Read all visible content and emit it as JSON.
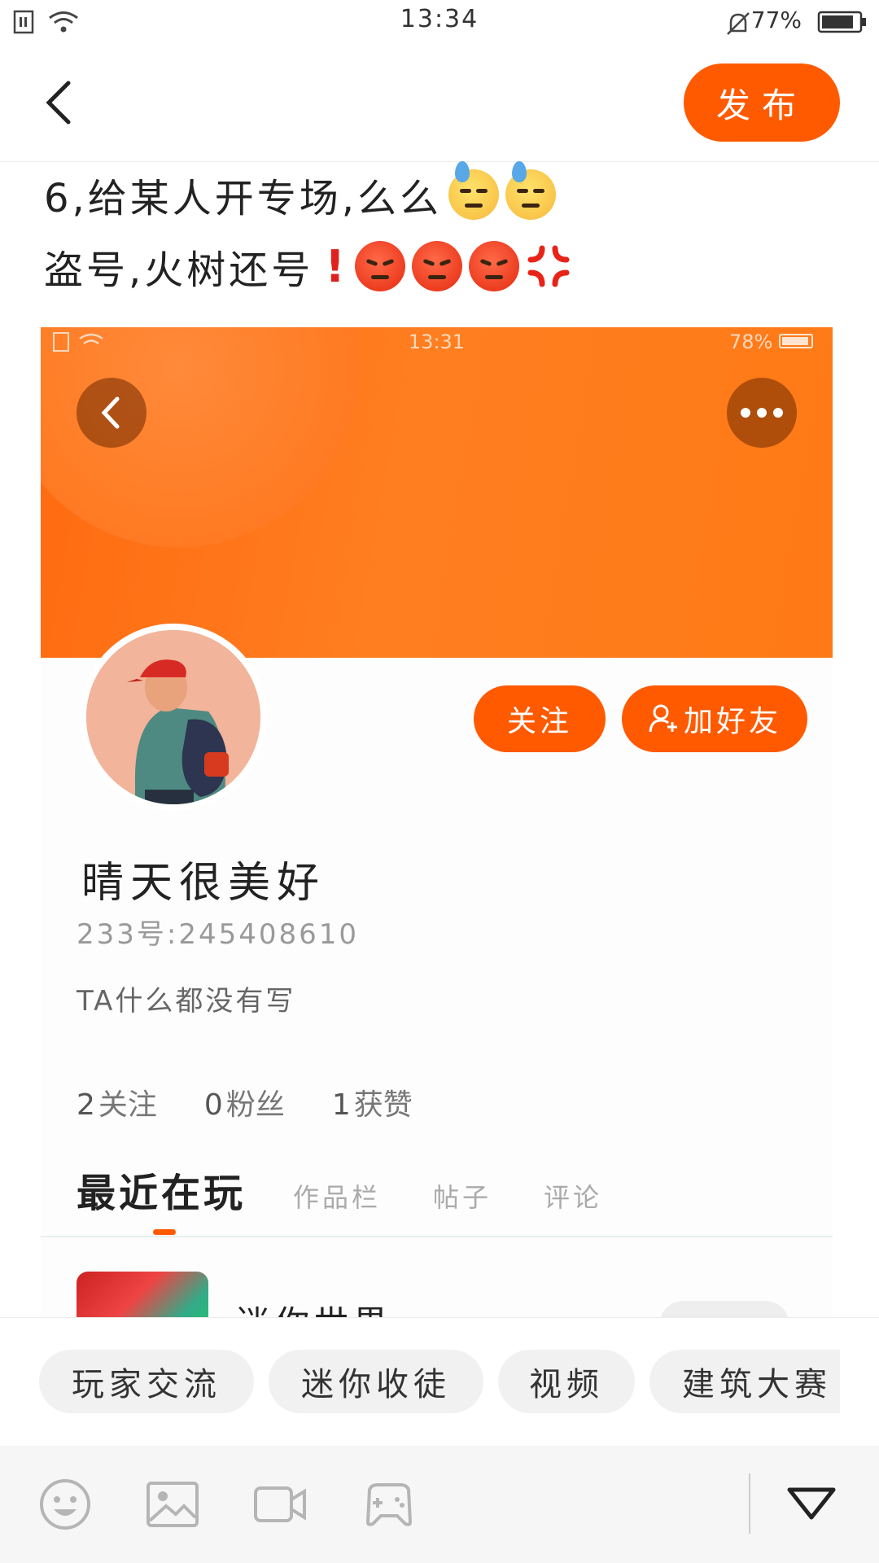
{
  "status_bar": {
    "time": "13:34",
    "battery": "77%"
  },
  "header": {
    "back_label": "",
    "publish_label": "发布"
  },
  "post": {
    "line1": "6,给某人开专场,么么",
    "line2": "盗号,火树还号"
  },
  "profile_screenshot": {
    "status_time": "13:31",
    "status_battery": "78%",
    "follow_label": "关注",
    "add_friend_label": "加好友",
    "username": "晴天很美好",
    "user_id": "233号:245408610",
    "bio": "TA什么都没有写",
    "stats": [
      {
        "num": "2",
        "label": "关注"
      },
      {
        "num": "0",
        "label": "粉丝"
      },
      {
        "num": "1",
        "label": "获赞"
      }
    ],
    "tabs": [
      "最近在玩",
      "作品栏",
      "帖子",
      "评论"
    ],
    "active_tab": 0,
    "recent_game": "迷你世界"
  },
  "topic_chips": [
    "玩家交流",
    "迷你收徒",
    "视频",
    "建筑大赛"
  ],
  "toolbar": {
    "icons": [
      "emoji-icon",
      "image-icon",
      "video-icon",
      "game-controller-icon",
      "collapse-triangle-icon"
    ]
  },
  "colors": {
    "accent": "#ff5a00",
    "banner": "#ff7a1a"
  }
}
